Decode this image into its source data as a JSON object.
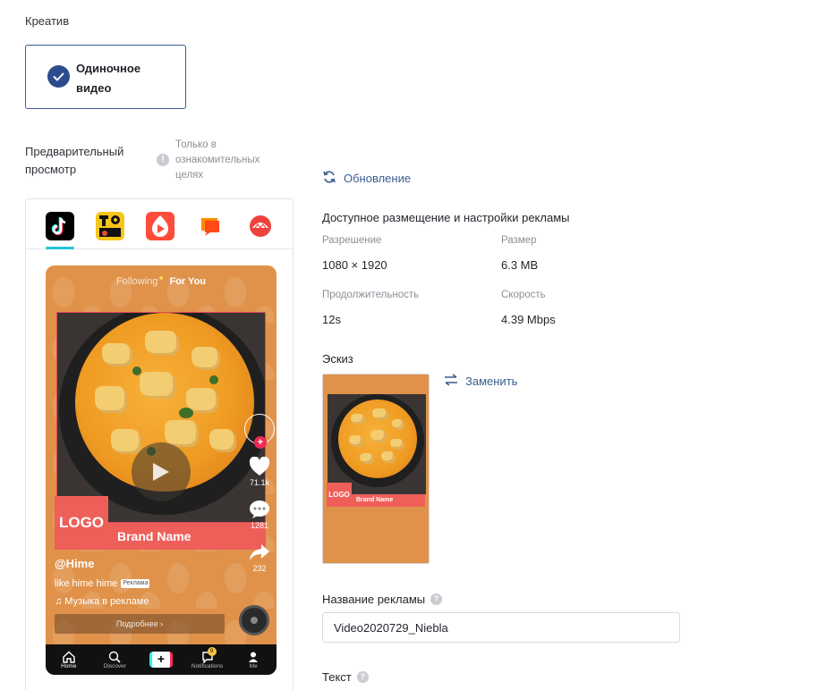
{
  "creative": {
    "section_title": "Креатив",
    "type_label": "Одиночное видео"
  },
  "preview": {
    "label": "Предварительный просмотр",
    "info_text": "Только в ознакомительных целях",
    "refresh_label": "Обновление",
    "platforms": [
      "tiktok-icon",
      "topbuzz-icon",
      "vigo-icon",
      "buzzvideo-icon",
      "pangle-icon"
    ],
    "phone": {
      "tab_following": "Following",
      "tab_foryou": "For You",
      "logo": "LOGO",
      "brand": "Brand Name",
      "handle": "@Hime",
      "caption": "like hime hime",
      "ad_badge": "Реклама",
      "music": "♫ Музыка в рекламе",
      "details_button": "Подробнее ›",
      "likes": "71.1k",
      "comments": "1281",
      "shares": "232",
      "nav": {
        "home": "Home",
        "discover": "Discover",
        "notifications": "Notifications",
        "notifications_badge": "9",
        "me": "Me"
      }
    }
  },
  "placement": {
    "title": "Доступное размещение и настройки рекламы",
    "resolution_label": "Разрешение",
    "resolution_value": "1080 × 1920",
    "size_label": "Размер",
    "size_value": "6.3 MB",
    "duration_label": "Продолжительность",
    "duration_value": "12s",
    "speed_label": "Скорость",
    "speed_value": "4.39 Mbps"
  },
  "thumbnail": {
    "label": "Эскиз",
    "replace_label": "Заменить",
    "logo": "LOGO",
    "brand": "Brand Name"
  },
  "ad_name": {
    "label": "Название рекламы",
    "value": "Video2020729_Niebla"
  },
  "text_field": {
    "label": "Текст"
  },
  "colors": {
    "accent": "#3a5c8f",
    "check": "#2c4c8e",
    "brand_red": "#ef5f5a",
    "phone_bg": "#e0924a"
  }
}
